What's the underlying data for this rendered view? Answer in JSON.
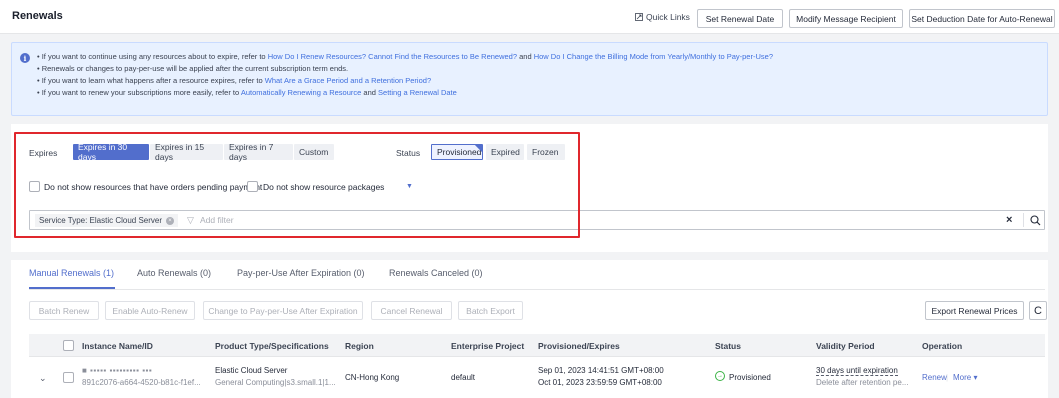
{
  "header": {
    "title": "Renewals",
    "quick_links": "Quick Links",
    "buttons": [
      "Set Renewal Date",
      "Modify Message Recipient",
      "Set Deduction Date for Auto-Renewal"
    ]
  },
  "notice": {
    "line1": {
      "prefix": "If you want to continue using any resources about to expire, refer to ",
      "link1": "How Do I Renew Resources?",
      "link2": "Cannot Find the Resources to Be Renewed?",
      "mid": " and ",
      "link3": "How Do I Change the Billing Mode from Yearly/Monthly to Pay-per-Use?"
    },
    "line2": "Renewals or changes to pay-per-use will be applied after the current subscription term ends.",
    "line3": {
      "prefix": "If you want to learn what happens after a resource expires, refer to ",
      "link": "What Are a Grace Period and a Retention Period?"
    },
    "line4": {
      "prefix": "If you want to renew your subscriptions more easily, refer to ",
      "link1": "Automatically Renewing a Resource",
      "mid": " and ",
      "link2": "Setting a Renewal Date"
    }
  },
  "filters": {
    "expires_label": "Expires",
    "expires_options": [
      "Expires in 30 days",
      "Expires in 15 days",
      "Expires in 7 days",
      "Custom"
    ],
    "status_label": "Status",
    "status_options": [
      "Provisioned",
      "Expired",
      "Frozen"
    ],
    "checkbox1": "Do not show resources that have orders pending payment",
    "checkbox2": "Do not show resource packages",
    "search_tag": "Service Type: Elastic Cloud Server",
    "add_filter_placeholder": "Add filter"
  },
  "tabs": [
    "Manual Renewals (1)",
    "Auto Renewals (0)",
    "Pay-per-Use After Expiration (0)",
    "Renewals Canceled (0)"
  ],
  "actions": [
    "Batch Renew",
    "Enable Auto-Renew",
    "Change to Pay-per-Use After Expiration",
    "Cancel Renewal",
    "Batch Export"
  ],
  "export_label": "Export Renewal Prices",
  "table": {
    "columns": [
      "Instance Name/ID",
      "Product Type/Specifications",
      "Region",
      "Enterprise Project",
      "Provisioned/Expires",
      "Status",
      "Validity Period",
      "Operation"
    ],
    "row": {
      "name": "■ ▪▪▪▪▪ ▪▪▪▪▪▪▪▪▪ ▪▪▪",
      "id": "891c2076-a664-4520-b81c-f1ef...",
      "product": "Elastic Cloud Server",
      "spec": "General Computing|s3.small.1|1...",
      "region": "CN-Hong Kong",
      "project": "default",
      "provisioned": "Sep 01, 2023 14:41:51 GMT+08:00",
      "expires": "Oct 01, 2023 23:59:59 GMT+08:00",
      "status": "Provisioned",
      "validity": "30 days until expiration",
      "validity_note": "Delete after retention pe...",
      "renew": "Renew",
      "more": "More"
    }
  }
}
